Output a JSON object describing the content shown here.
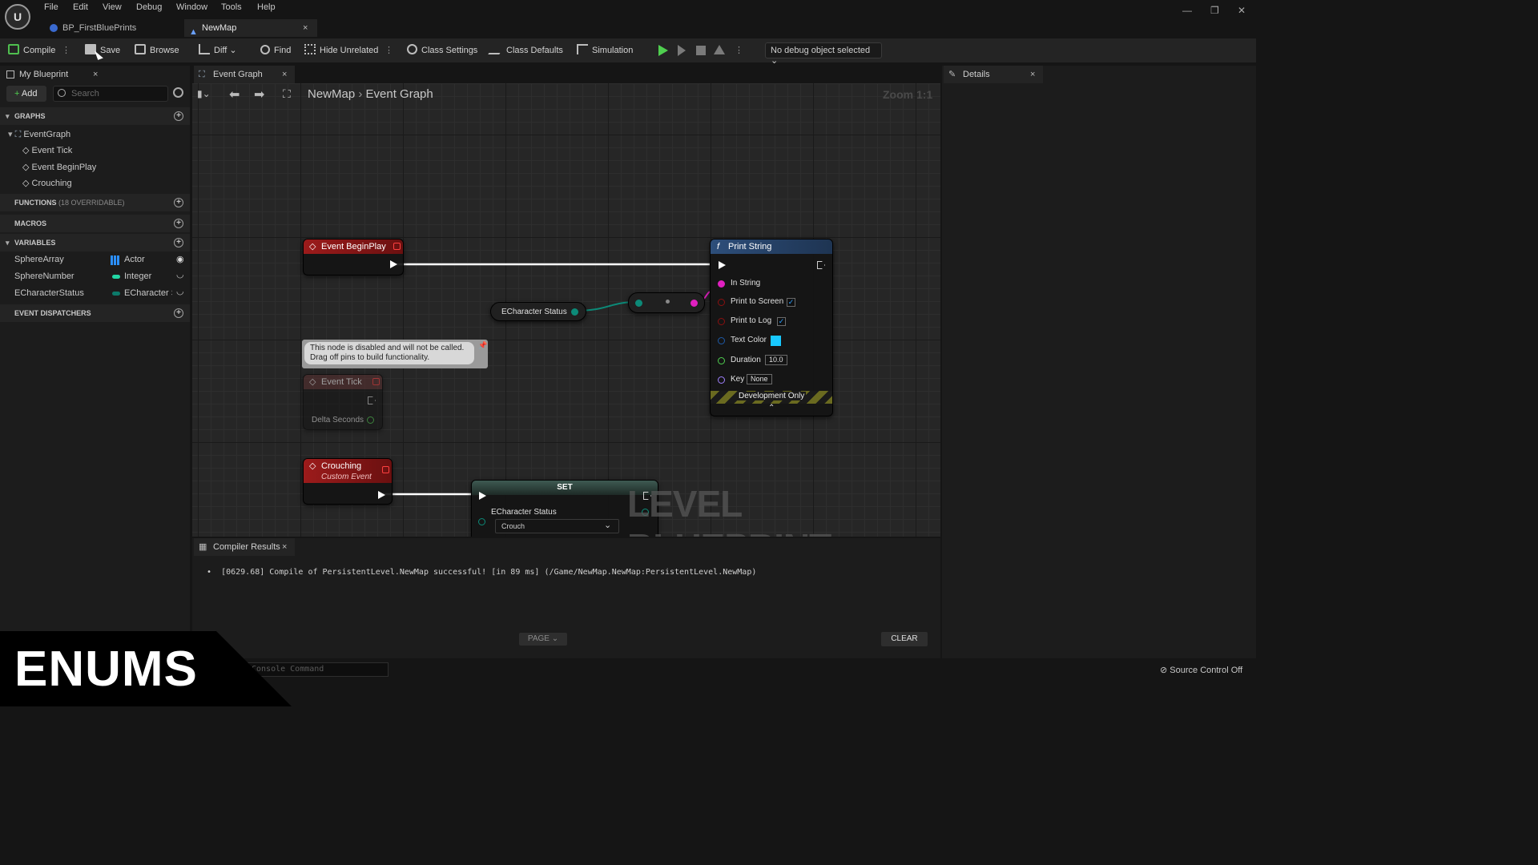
{
  "menu": [
    "File",
    "Edit",
    "View",
    "Debug",
    "Window",
    "Tools",
    "Help"
  ],
  "doc_tabs": [
    {
      "label": "BP_FirstBluePrints"
    },
    {
      "label": "NewMap"
    }
  ],
  "toolbar": {
    "compile": "Compile",
    "save": "Save",
    "browse": "Browse",
    "diff": "Diff",
    "find": "Find",
    "hide_unrelated": "Hide Unrelated",
    "class_settings": "Class Settings",
    "class_defaults": "Class Defaults",
    "simulation": "Simulation",
    "debug_object": "No debug object selected"
  },
  "my_blueprint": {
    "tab": "My Blueprint",
    "add": "Add",
    "search_placeholder": "Search",
    "graphs_header": "GRAPHS",
    "event_graph": "EventGraph",
    "graph_items": [
      "Event Tick",
      "Event BeginPlay",
      "Crouching"
    ],
    "functions_header": "FUNCTIONS",
    "functions_note": "(18 OVERRIDABLE)",
    "macros_header": "MACROS",
    "variables_header": "VARIABLES",
    "variables": [
      {
        "name": "SphereArray",
        "type": "Actor",
        "color": "#2b8fff"
      },
      {
        "name": "SphereNumber",
        "type": "Integer",
        "color": "#22d6a4"
      },
      {
        "name": "ECharacterStatus",
        "type": "ECharacter S",
        "color": "#0c7a6a"
      }
    ],
    "dispatchers_header": "EVENT DISPATCHERS"
  },
  "graph": {
    "tab": "Event Graph",
    "breadcrumb_root": "NewMap",
    "breadcrumb_leaf": "Event Graph",
    "zoom": "Zoom 1:1",
    "watermark": "LEVEL BLUEPRINT",
    "begin_play": "Event BeginPlay",
    "print_string": {
      "title": "Print String",
      "in_string": "In String",
      "print_to_screen": "Print to Screen",
      "print_to_log": "Print to Log",
      "text_color": "Text Color",
      "duration": "Duration",
      "duration_value": "10.0",
      "key": "Key",
      "key_value": "None",
      "dev_only": "Development Only"
    },
    "echar_status_node": "ECharacter Status",
    "disabled_comment_line1": "This node is disabled and will not be called.",
    "disabled_comment_line2": "Drag off pins to build functionality.",
    "event_tick": "Event Tick",
    "delta_seconds": "Delta Seconds",
    "crouching": "Crouching",
    "custom_event": "Custom Event",
    "set_title": "SET",
    "set_var": "ECharacter Status",
    "set_value": "Crouch"
  },
  "compiler": {
    "tab": "Compiler Results",
    "message": "[0629.68] Compile of PersistentLevel.NewMap successful! [in 89 ms] (/Game/NewMap.NewMap:PersistentLevel.NewMap)",
    "page": "PAGE",
    "clear": "CLEAR"
  },
  "details": {
    "tab": "Details"
  },
  "status": {
    "console_placeholder": "Console Command",
    "source_control": "Source Control Off"
  },
  "overlay_title": "ENUMS"
}
